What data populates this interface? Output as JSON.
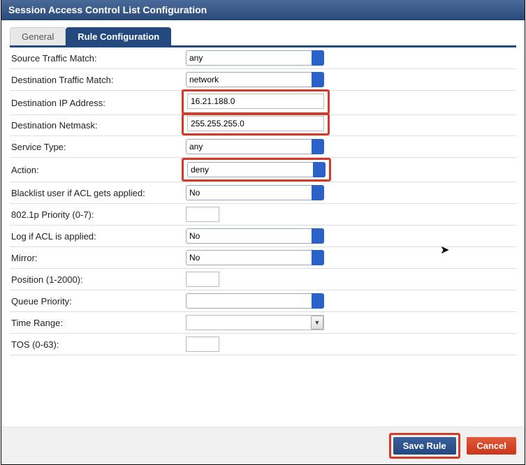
{
  "title": "Session Access Control List Configuration",
  "tabs": {
    "general": "General",
    "rule": "Rule Configuration"
  },
  "labels": {
    "srcMatch": "Source Traffic Match:",
    "dstMatch": "Destination Traffic Match:",
    "dstIP": "Destination IP Address:",
    "dstMask": "Destination Netmask:",
    "svcType": "Service Type:",
    "action": "Action:",
    "blacklist": "Blacklist user if ACL gets applied:",
    "dot1p": "802.1p Priority (0-7):",
    "logAcl": "Log if ACL is applied:",
    "mirror": "Mirror:",
    "position": "Position (1-2000):",
    "queue": "Queue Priority:",
    "timeRange": "Time Range:",
    "tos": "TOS (0-63):"
  },
  "values": {
    "srcMatch": "any",
    "dstMatch": "network",
    "dstIP": "16.21.188.0",
    "dstMask": "255.255.255.0",
    "svcType": "any",
    "action": "deny",
    "blacklist": "No",
    "dot1p": "",
    "logAcl": "No",
    "mirror": "No",
    "position": "",
    "queue": "",
    "timeRange": "",
    "tos": ""
  },
  "buttons": {
    "save": "Save Rule",
    "cancel": "Cancel"
  }
}
